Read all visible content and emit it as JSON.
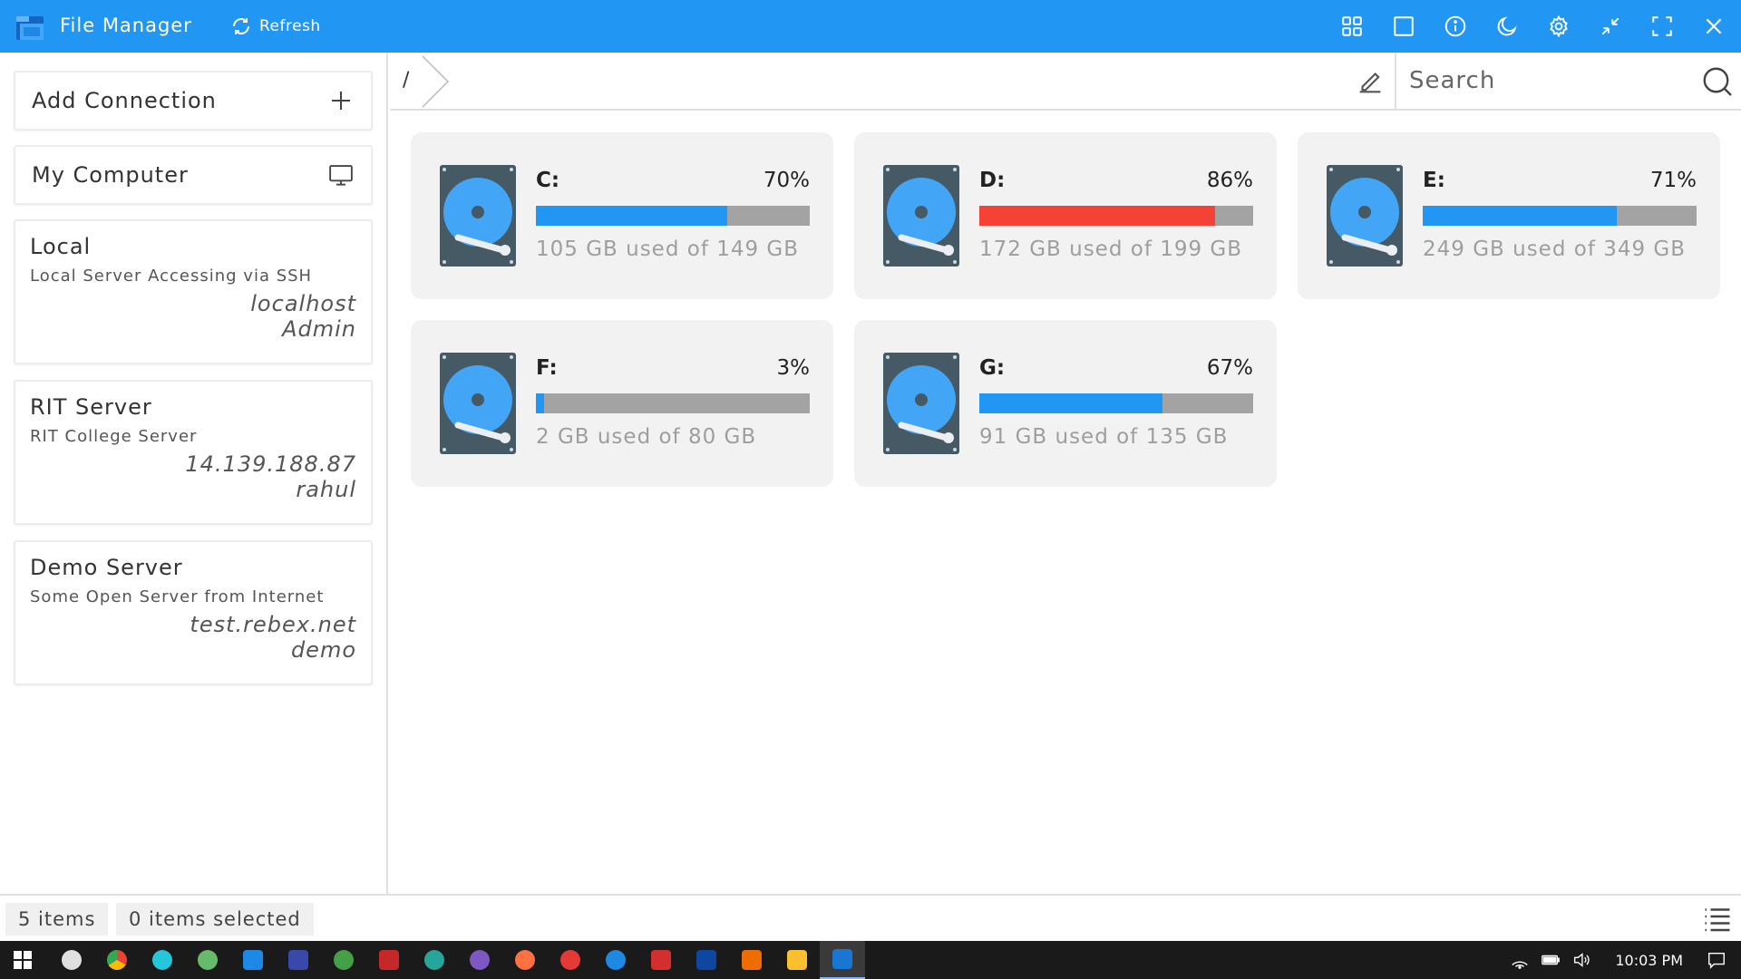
{
  "app": {
    "title": "File Manager",
    "refresh_label": "Refresh"
  },
  "sidebar": {
    "add_connection_label": "Add Connection",
    "my_computer_label": "My Computer",
    "connections": [
      {
        "name": "Local",
        "description": "Local Server Accessing via SSH",
        "host": "localhost",
        "user": "Admin"
      },
      {
        "name": "RIT Server",
        "description": "RIT College Server",
        "host": "14.139.188.87",
        "user": "rahul"
      },
      {
        "name": "Demo Server",
        "description": "Some Open Server from Internet",
        "host": "test.rebex.net",
        "user": "demo"
      }
    ]
  },
  "addressbar": {
    "path": "/",
    "search_placeholder": "Search"
  },
  "drives": [
    {
      "name": "C:",
      "percent_label": "70%",
      "used_fraction": 0.7,
      "usage": "105 GB used of 149 GB",
      "bar_color": "#2196f3"
    },
    {
      "name": "D:",
      "percent_label": "86%",
      "used_fraction": 0.86,
      "usage": "172 GB used of 199 GB",
      "bar_color": "#f44336"
    },
    {
      "name": "E:",
      "percent_label": "71%",
      "used_fraction": 0.71,
      "usage": "249 GB used of 349 GB",
      "bar_color": "#2196f3"
    },
    {
      "name": "F:",
      "percent_label": "3%",
      "used_fraction": 0.03,
      "usage": "2 GB used of 80 GB",
      "bar_color": "#2196f3"
    },
    {
      "name": "G:",
      "percent_label": "67%",
      "used_fraction": 0.67,
      "usage": "91 GB used of 135 GB",
      "bar_color": "#2196f3"
    }
  ],
  "statusbar": {
    "items_count": "5 items",
    "selected_count": "0 items selected"
  },
  "taskbar": {
    "clock": "10:03 PM"
  },
  "colors": {
    "accent": "#2196f3",
    "danger": "#f44336",
    "bar_track": "#a3a3a3",
    "card_bg": "#f2f2f2"
  }
}
